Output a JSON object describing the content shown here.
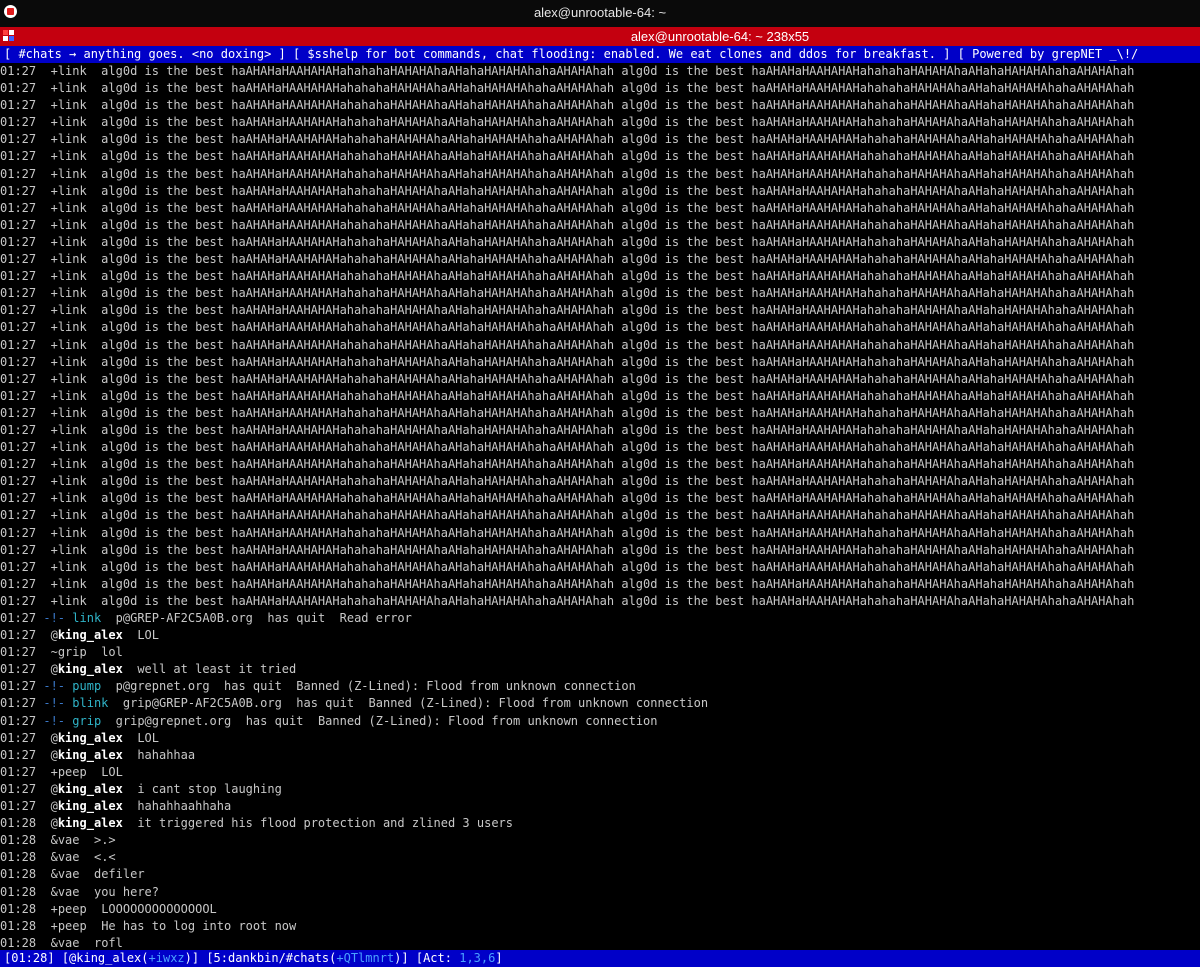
{
  "window": {
    "title": "alex@unrootable-64: ~"
  },
  "tab": {
    "title": "alex@unrootable-64: ~ 238x55"
  },
  "topic": "[ #chats → anything goes. <no doxing> ] [ $sshelp for bot commands, chat flooding: enabled. We eat clones and ddos for breakfast. ] [ Powered by grepNET _\\!/",
  "flood": {
    "time": "01:27",
    "mode": "+",
    "nick": "link",
    "text": "alg0d is the best haAHAHaHAAHAHAHahahahaHAHAHAhaAHahaHAHAHAhahaAHAHAhah alg0d is the best haAHAHaHAAHAHAHahahahaHAHAHAhaAHahaHAHAHAhahaAHAHAhah"
  },
  "messages": [
    {
      "time": "01:27",
      "type": "quit",
      "arrow": "-!-",
      "nick": "link",
      "host": "p@GREP-AF2C5A0B.org",
      "action": "has quit",
      "reason": "Read error"
    },
    {
      "time": "01:27",
      "type": "msg",
      "mode": "@",
      "nick": "king_alex",
      "bold": true,
      "text": "LOL"
    },
    {
      "time": "01:27",
      "type": "msg",
      "mode": "~",
      "nick": "grip",
      "bold": false,
      "text": "lol"
    },
    {
      "time": "01:27",
      "type": "msg",
      "mode": "@",
      "nick": "king_alex",
      "bold": true,
      "text": "well at least it tried"
    },
    {
      "time": "01:27",
      "type": "quit",
      "arrow": "-!-",
      "nick": "pump",
      "host": "p@grepnet.org",
      "action": "has quit",
      "reason": "Banned (Z-Lined): Flood from unknown connection"
    },
    {
      "time": "01:27",
      "type": "quit",
      "arrow": "-!-",
      "nick": "blink",
      "host": "grip@GREP-AF2C5A0B.org",
      "action": "has quit",
      "reason": "Banned (Z-Lined): Flood from unknown connection"
    },
    {
      "time": "01:27",
      "type": "quit",
      "arrow": "-!-",
      "nick": "grip",
      "host": "grip@grepnet.org",
      "action": "has quit",
      "reason": "Banned (Z-Lined): Flood from unknown connection"
    },
    {
      "time": "01:27",
      "type": "msg",
      "mode": "@",
      "nick": "king_alex",
      "bold": true,
      "text": "LOL"
    },
    {
      "time": "01:27",
      "type": "msg",
      "mode": "@",
      "nick": "king_alex",
      "bold": true,
      "text": "hahahhaa"
    },
    {
      "time": "01:27",
      "type": "msg",
      "mode": "+",
      "nick": "peep",
      "bold": false,
      "text": "LOL"
    },
    {
      "time": "01:27",
      "type": "msg",
      "mode": "@",
      "nick": "king_alex",
      "bold": true,
      "text": "i cant stop laughing"
    },
    {
      "time": "01:27",
      "type": "msg",
      "mode": "@",
      "nick": "king_alex",
      "bold": true,
      "text": "hahahhaahhaha"
    },
    {
      "time": "01:28",
      "type": "msg",
      "mode": "@",
      "nick": "king_alex",
      "bold": true,
      "text": "it triggered his flood protection and zlined 3 users"
    },
    {
      "time": "01:28",
      "type": "msg",
      "mode": "&",
      "nick": "vae",
      "bold": false,
      "text": ">.>"
    },
    {
      "time": "01:28",
      "type": "msg",
      "mode": "&",
      "nick": "vae",
      "bold": false,
      "text": "<.<"
    },
    {
      "time": "01:28",
      "type": "msg",
      "mode": "&",
      "nick": "vae",
      "bold": false,
      "text": "defiler"
    },
    {
      "time": "01:28",
      "type": "msg",
      "mode": "&",
      "nick": "vae",
      "bold": false,
      "text": "you here?"
    },
    {
      "time": "01:28",
      "type": "msg",
      "mode": "+",
      "nick": "peep",
      "bold": false,
      "text": "LOOOOOOOOOOOOOOL"
    },
    {
      "time": "01:28",
      "type": "msg",
      "mode": "+",
      "nick": "peep",
      "bold": false,
      "text": "He has to log into root now"
    },
    {
      "time": "01:28",
      "type": "msg",
      "mode": "&",
      "nick": "vae",
      "bold": false,
      "text": "rofl"
    }
  ],
  "statusbar": {
    "time": "[01:28]",
    "user_prefix": "[@king_alex(",
    "user_modes": "+iwxz",
    "user_suffix": ")]",
    "window_prefix": "[5:dankbin/#chats(",
    "channel_modes": "+QTlmnrt",
    "window_suffix": ")]",
    "act_prefix": "[Act: ",
    "act_values": "1,3,6",
    "act_suffix": "]"
  },
  "colors": {
    "title_bg": "#0a0a0a",
    "tab_bg": "#c4000f",
    "bar_bg": "#0000c8",
    "arrow": "#3a78c8",
    "quit_nick": "#2fb4c8"
  }
}
